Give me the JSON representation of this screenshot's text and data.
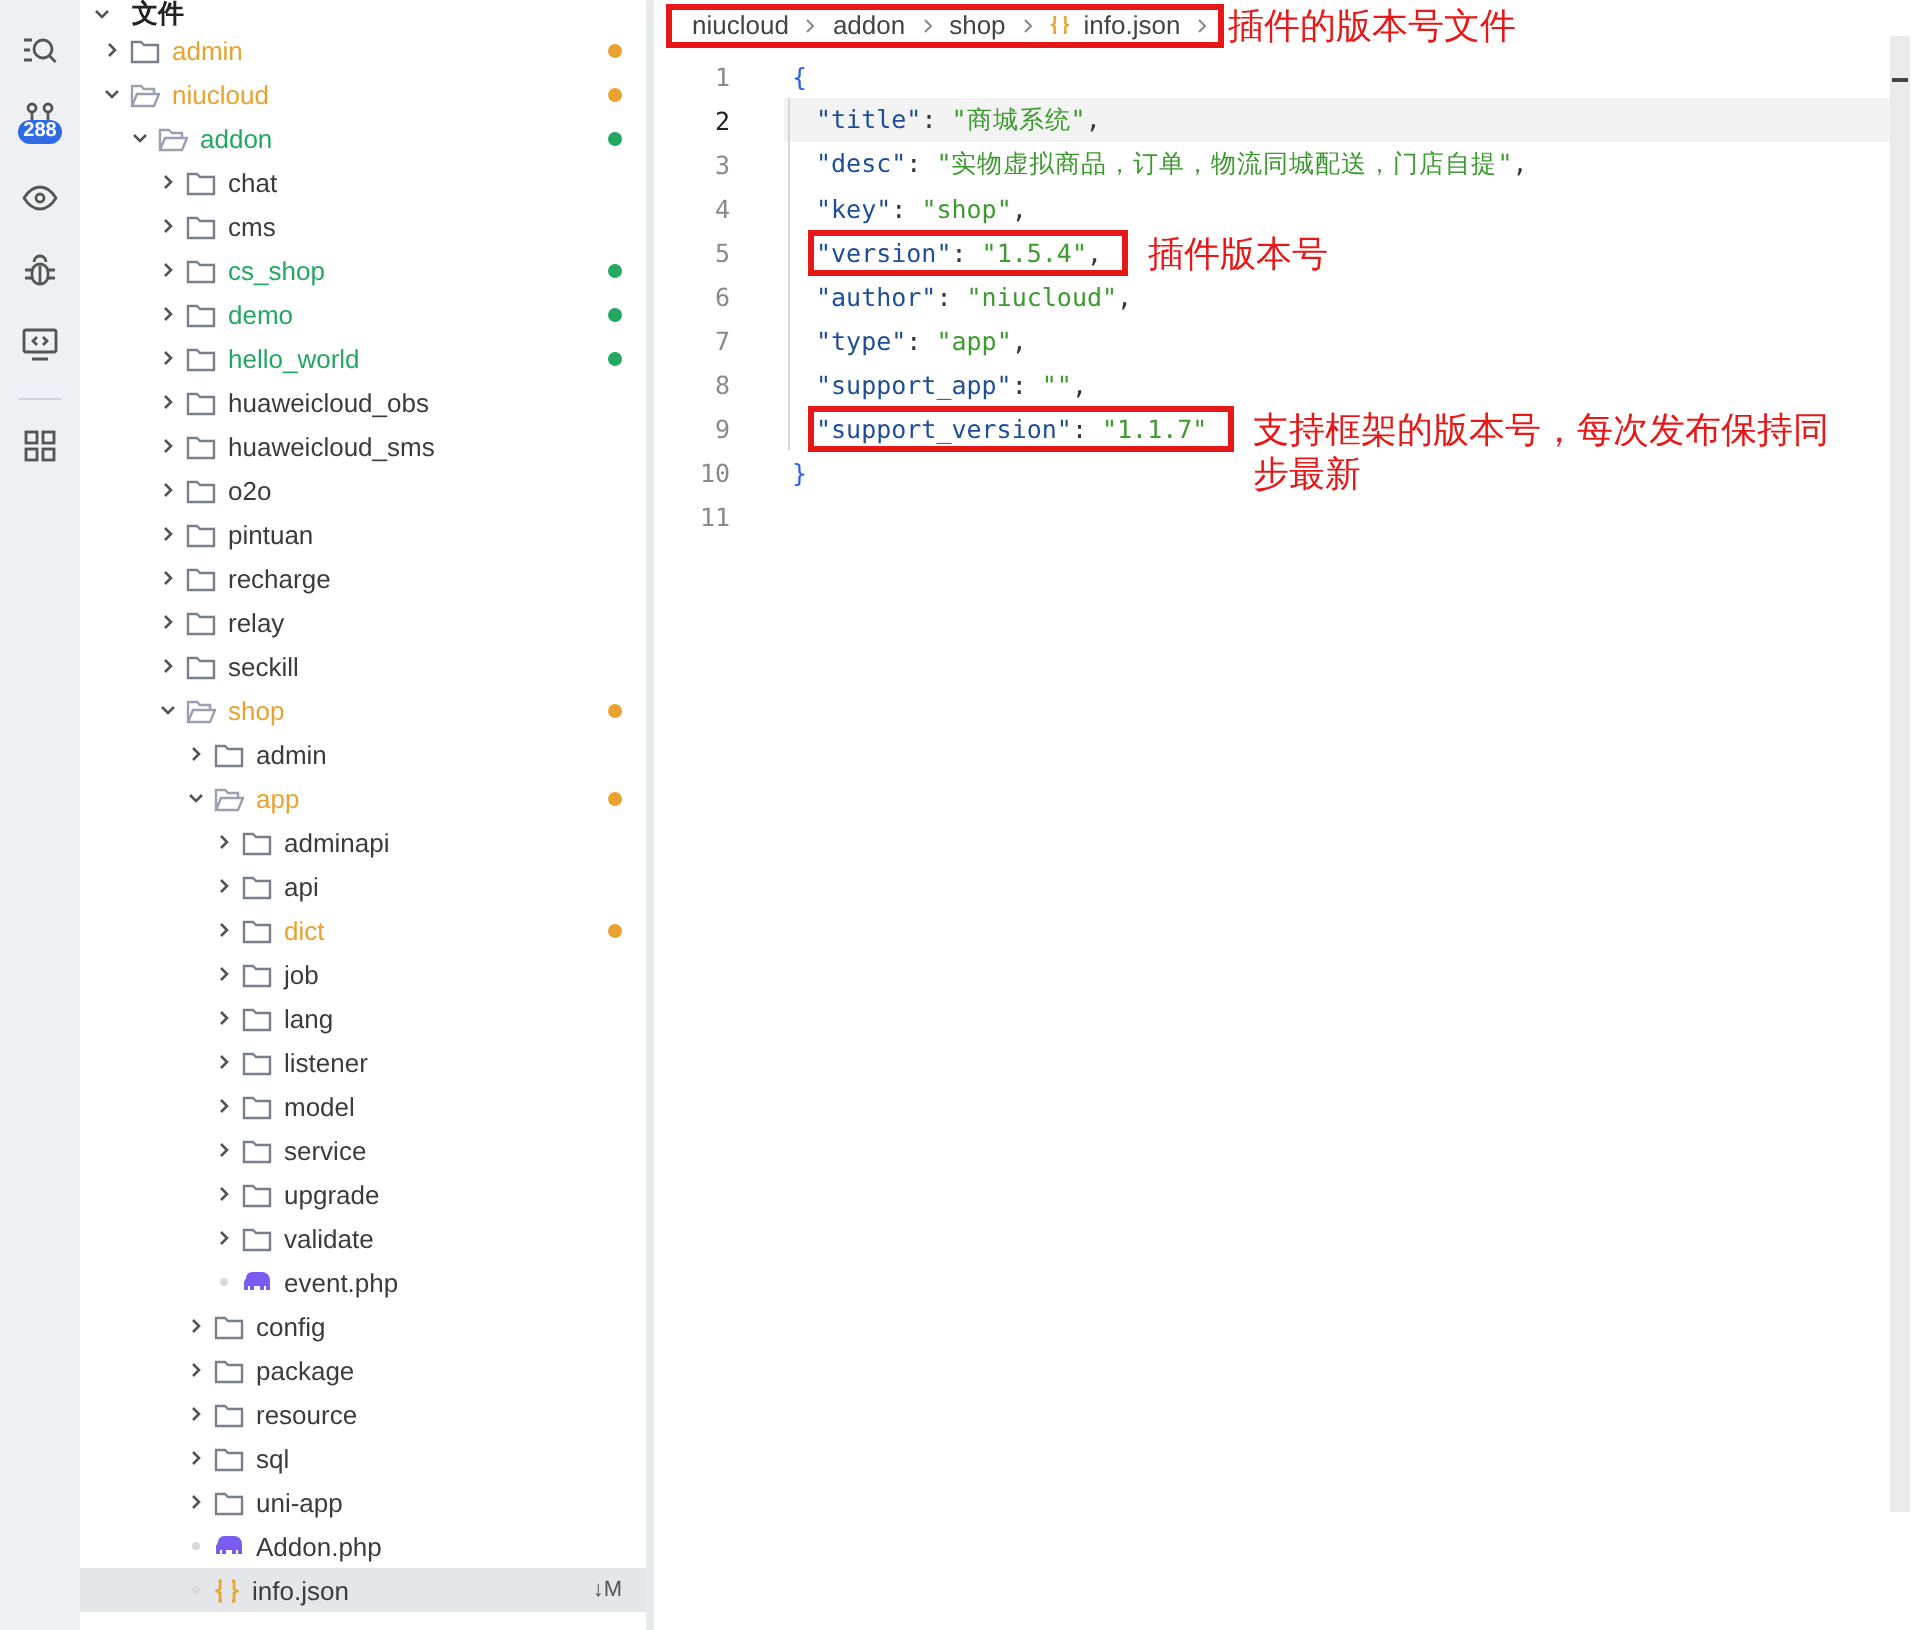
{
  "activity_bar": {
    "items": [
      {
        "kind": "search"
      },
      {
        "kind": "source_control",
        "badge": "288"
      },
      {
        "kind": "eye"
      },
      {
        "kind": "bug"
      },
      {
        "kind": "remote"
      },
      {
        "kind": "extensions"
      }
    ]
  },
  "tree": {
    "title": "文件",
    "expanded": true,
    "children": [
      {
        "name": "admin",
        "kind": "folder",
        "expanded": false,
        "color": "#e9a230",
        "selected": false
      },
      {
        "name": "niucloud",
        "kind": "folder",
        "expanded": true,
        "color": "#e9a230",
        "selected": false,
        "children": [
          {
            "name": "addon",
            "kind": "folder",
            "expanded": true,
            "color": "#22a861",
            "selected": false,
            "children": [
              {
                "name": "chat",
                "kind": "folder",
                "expanded": false,
                "selected": false
              },
              {
                "name": "cms",
                "kind": "folder",
                "expanded": false,
                "selected": false
              },
              {
                "name": "cs_shop",
                "kind": "folder",
                "expanded": false,
                "color": "#22a861",
                "selected": false
              },
              {
                "name": "demo",
                "kind": "folder",
                "expanded": false,
                "color": "#22a861",
                "selected": false
              },
              {
                "name": "hello_world",
                "kind": "folder",
                "expanded": false,
                "color": "#22a861",
                "selected": false
              },
              {
                "name": "huaweicloud_obs",
                "kind": "folder",
                "expanded": false,
                "selected": false
              },
              {
                "name": "huaweicloud_sms",
                "kind": "folder",
                "expanded": false,
                "selected": false
              },
              {
                "name": "o2o",
                "kind": "folder",
                "expanded": false,
                "selected": false
              },
              {
                "name": "pintuan",
                "kind": "folder",
                "expanded": false,
                "selected": false
              },
              {
                "name": "recharge",
                "kind": "folder",
                "expanded": false,
                "selected": false
              },
              {
                "name": "relay",
                "kind": "folder",
                "expanded": false,
                "selected": false
              },
              {
                "name": "seckill",
                "kind": "folder",
                "expanded": false,
                "selected": false
              },
              {
                "name": "shop",
                "kind": "folder",
                "expanded": true,
                "color": "#e9a230",
                "selected": false,
                "children": [
                  {
                    "name": "admin",
                    "kind": "folder",
                    "expanded": false,
                    "selected": false
                  },
                  {
                    "name": "app",
                    "kind": "folder",
                    "expanded": true,
                    "color": "#e9a230",
                    "selected": false,
                    "children": [
                      {
                        "name": "adminapi",
                        "kind": "folder",
                        "expanded": false,
                        "selected": false
                      },
                      {
                        "name": "api",
                        "kind": "folder",
                        "expanded": false,
                        "selected": false
                      },
                      {
                        "name": "dict",
                        "kind": "folder",
                        "expanded": false,
                        "color": "#e9a230",
                        "selected": false
                      },
                      {
                        "name": "job",
                        "kind": "folder",
                        "expanded": false,
                        "selected": false
                      },
                      {
                        "name": "lang",
                        "kind": "folder",
                        "expanded": false,
                        "selected": false
                      },
                      {
                        "name": "listener",
                        "kind": "folder",
                        "expanded": false,
                        "selected": false
                      },
                      {
                        "name": "model",
                        "kind": "folder",
                        "expanded": false,
                        "selected": false
                      },
                      {
                        "name": "service",
                        "kind": "folder",
                        "expanded": false,
                        "selected": false
                      },
                      {
                        "name": "upgrade",
                        "kind": "folder",
                        "expanded": false,
                        "selected": false
                      },
                      {
                        "name": "validate",
                        "kind": "folder",
                        "expanded": false,
                        "selected": false
                      },
                      {
                        "name": "event.php",
                        "kind": "php",
                        "selected": false
                      }
                    ]
                  },
                  {
                    "name": "config",
                    "kind": "folder",
                    "expanded": false,
                    "selected": false
                  },
                  {
                    "name": "package",
                    "kind": "folder",
                    "expanded": false,
                    "selected": false
                  },
                  {
                    "name": "resource",
                    "kind": "folder",
                    "expanded": false,
                    "selected": false
                  },
                  {
                    "name": "sql",
                    "kind": "folder",
                    "expanded": false,
                    "selected": false
                  },
                  {
                    "name": "uni-app",
                    "kind": "folder",
                    "expanded": false,
                    "selected": false
                  },
                  {
                    "name": "Addon.php",
                    "kind": "php",
                    "selected": false
                  },
                  {
                    "name": "info.json",
                    "kind": "json",
                    "selected": true,
                    "badge": "↓M"
                  }
                ]
              }
            ]
          }
        ]
      }
    ]
  },
  "editor": {
    "breadcrumb": {
      "items": [
        {
          "text": "niucloud",
          "kind": "folder"
        },
        {
          "text": "addon",
          "kind": "folder"
        },
        {
          "text": "shop",
          "kind": "folder"
        },
        {
          "text": "info.json",
          "kind": "json"
        }
      ],
      "boxed": true,
      "note": "插件的版本号文件"
    },
    "lines": [
      {
        "number": "1",
        "current": false,
        "tokens": [
          {
            "kind": "brace",
            "text": "{"
          }
        ]
      },
      {
        "number": "2",
        "current": true,
        "tokens": [
          {
            "kind": "key",
            "text": "\"title\""
          },
          {
            "kind": "punct",
            "text": ": "
          },
          {
            "kind": "string",
            "text": "\"商城系统\""
          },
          {
            "kind": "punct",
            "text": ","
          }
        ]
      },
      {
        "number": "3",
        "current": false,
        "tokens": [
          {
            "kind": "key",
            "text": "\"desc\""
          },
          {
            "kind": "punct",
            "text": ": "
          },
          {
            "kind": "string",
            "text": "\"实物虚拟商品，订单，物流同城配送，门店自提\""
          },
          {
            "kind": "punct",
            "text": ","
          }
        ]
      },
      {
        "number": "4",
        "current": false,
        "tokens": [
          {
            "kind": "key",
            "text": "\"key\""
          },
          {
            "kind": "punct",
            "text": ": "
          },
          {
            "kind": "string",
            "text": "\"shop\""
          },
          {
            "kind": "punct",
            "text": ","
          }
        ]
      },
      {
        "number": "5",
        "current": false,
        "boxed": true,
        "note": "插件版本号",
        "tokens": [
          {
            "kind": "key",
            "text": "\"version\""
          },
          {
            "kind": "punct",
            "text": ": "
          },
          {
            "kind": "string",
            "text": "\"1.5.4\""
          },
          {
            "kind": "punct",
            "text": ","
          }
        ]
      },
      {
        "number": "6",
        "current": false,
        "tokens": [
          {
            "kind": "key",
            "text": "\"author\""
          },
          {
            "kind": "punct",
            "text": ": "
          },
          {
            "kind": "string",
            "text": "\"niucloud\""
          },
          {
            "kind": "punct",
            "text": ","
          }
        ]
      },
      {
        "number": "7",
        "current": false,
        "tokens": [
          {
            "kind": "key",
            "text": "\"type\""
          },
          {
            "kind": "punct",
            "text": ": "
          },
          {
            "kind": "string",
            "text": "\"app\""
          },
          {
            "kind": "punct",
            "text": ","
          }
        ]
      },
      {
        "number": "8",
        "current": false,
        "tokens": [
          {
            "kind": "key",
            "text": "\"support_app\""
          },
          {
            "kind": "punct",
            "text": ": "
          },
          {
            "kind": "string",
            "text": "\"\""
          },
          {
            "kind": "punct",
            "text": ","
          }
        ]
      },
      {
        "number": "9",
        "current": false,
        "boxed": true,
        "note": "支持框架的版本号，每次发布保持同步最新",
        "tokens": [
          {
            "kind": "key",
            "text": "\"support_version\""
          },
          {
            "kind": "punct",
            "text": ": "
          },
          {
            "kind": "string",
            "text": "\"1.1.7\""
          }
        ]
      },
      {
        "number": "10",
        "current": false,
        "tokens": [
          {
            "kind": "brace",
            "text": "}"
          }
        ]
      },
      {
        "number": "11",
        "current": false
      }
    ]
  }
}
